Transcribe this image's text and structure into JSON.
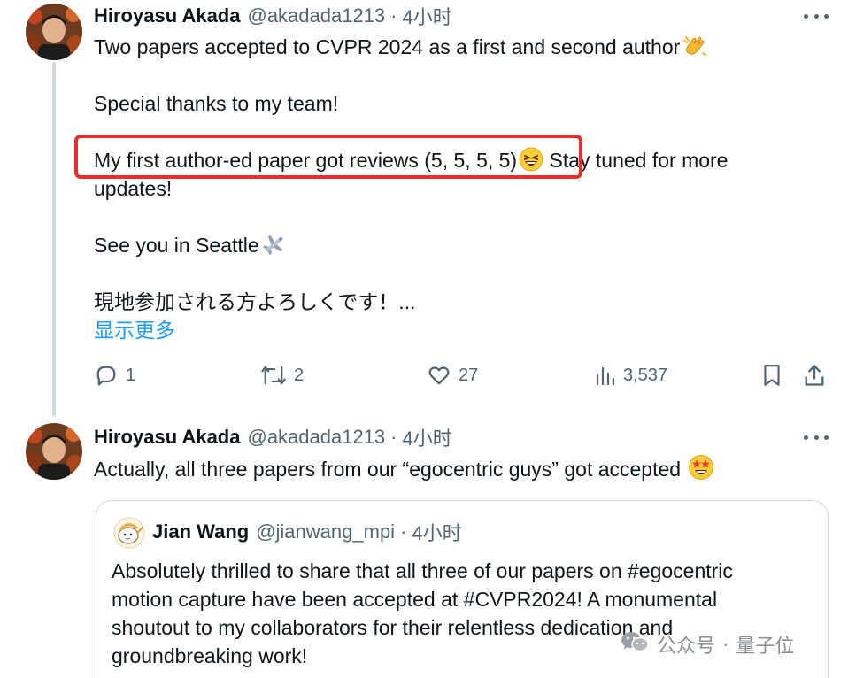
{
  "tweet1": {
    "name": "Hiroyasu Akada",
    "handle": "@akadada1213",
    "dot": "·",
    "time": "4小时",
    "lines": [
      "Two papers accepted to CVPR 2024 as a first and second author",
      "Special thanks to my team!",
      "My first author-ed paper got reviews (5, 5, 5, 5)",
      " Stay tuned for more",
      "updates!",
      "See you in Seattle",
      "現地参加される方よろしくです！..."
    ],
    "show_more": "显示更多",
    "emojis": [
      "clapping-hands",
      "grinning-squinting-face",
      "airplane"
    ],
    "actions": {
      "reply_count": "1",
      "retweet_count": "2",
      "like_count": "27",
      "views_count": "3,537"
    }
  },
  "tweet2": {
    "name": "Hiroyasu Akada",
    "handle": "@akadada1213",
    "dot": "·",
    "time": "4小时",
    "text": "Actually, all three papers from our “egocentric guys” got accepted",
    "emoji": "star-struck"
  },
  "quote": {
    "name": "Jian Wang",
    "handle": "@jianwang_mpi",
    "dot": "·",
    "time": "4小时",
    "lines": [
      "Absolutely thrilled to share that all three of our papers on #egocentric",
      "motion capture have been accepted at #CVPR2024! A monumental",
      "shoutout to my collaborators for their relentless dedication and",
      "groundbreaking work!"
    ]
  },
  "watermark": {
    "source": "公众号",
    "sep": "·",
    "account": "量子位"
  },
  "colors": {
    "text": "#0f1419",
    "muted": "#536471",
    "link": "#1d9bf0",
    "highlight": "#e0312b",
    "border": "#cfd9de"
  }
}
